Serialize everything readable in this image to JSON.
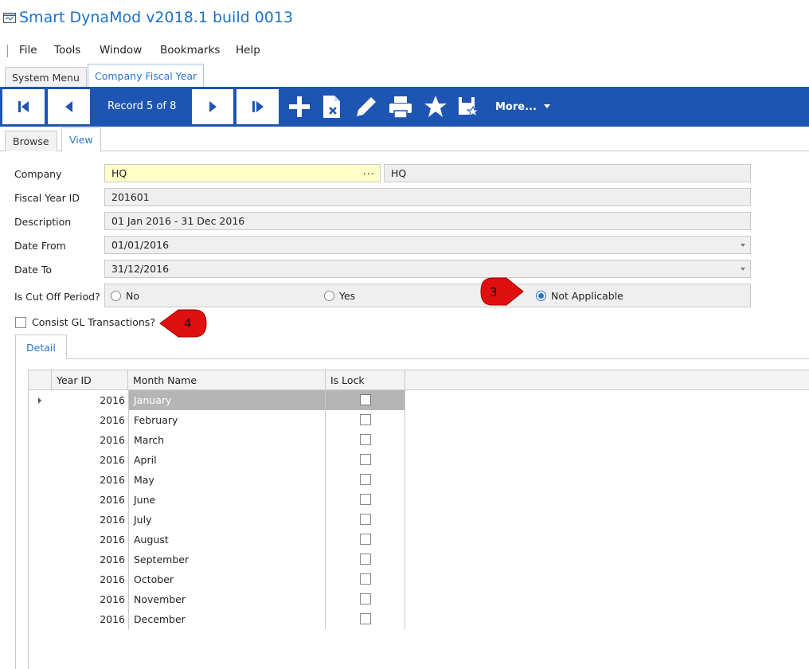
{
  "app": {
    "title": "Smart DynaMod v2018.1 build 0013"
  },
  "menu": {
    "items": [
      "File",
      "Tools",
      "Window",
      "Bookmarks",
      "Help"
    ]
  },
  "doc_tabs": [
    {
      "label": "System Menu",
      "active": false
    },
    {
      "label": "Company Fiscal Year",
      "active": true
    }
  ],
  "toolbar": {
    "record_label": "Record 5 of 8",
    "more_label": "More...",
    "accent_color": "#1e55b3",
    "icons": [
      "first-record-icon",
      "previous-record-icon",
      "next-record-icon",
      "last-record-icon",
      "add-icon",
      "delete-icon",
      "edit-icon",
      "print-icon",
      "bookmark-star-icon",
      "save-icon",
      "chevron-down-icon"
    ]
  },
  "view_tabs": [
    {
      "label": "Browse",
      "active": false
    },
    {
      "label": "View",
      "active": true
    }
  ],
  "form": {
    "company": {
      "label": "Company",
      "code": "HQ",
      "name": "HQ",
      "button": "..."
    },
    "fiscal_year_id": {
      "label": "Fiscal Year ID",
      "value": "201601"
    },
    "description": {
      "label": "Description",
      "value": "01 Jan 2016 - 31 Dec 2016"
    },
    "date_from": {
      "label": "Date From",
      "value": "01/01/2016"
    },
    "date_to": {
      "label": "Date To",
      "value": "31/12/2016"
    },
    "cut_off": {
      "label": "Is Cut Off Period?",
      "options": [
        "No",
        "Yes",
        "Not Applicable"
      ],
      "selected": "Not Applicable"
    },
    "consist_gl": {
      "label": "Consist GL Transactions?",
      "checked": false
    }
  },
  "callouts": [
    "3",
    "4"
  ],
  "detail": {
    "tab_label": "Detail",
    "columns": [
      "Year ID",
      "Month Name",
      "Is Lock"
    ],
    "rows": [
      {
        "year": "2016",
        "month": "January",
        "locked": false,
        "selected": true
      },
      {
        "year": "2016",
        "month": "February",
        "locked": false
      },
      {
        "year": "2016",
        "month": "March",
        "locked": false
      },
      {
        "year": "2016",
        "month": "April",
        "locked": false
      },
      {
        "year": "2016",
        "month": "May",
        "locked": false
      },
      {
        "year": "2016",
        "month": "June",
        "locked": false
      },
      {
        "year": "2016",
        "month": "July",
        "locked": false
      },
      {
        "year": "2016",
        "month": "August",
        "locked": false
      },
      {
        "year": "2016",
        "month": "September",
        "locked": false
      },
      {
        "year": "2016",
        "month": "October",
        "locked": false
      },
      {
        "year": "2016",
        "month": "November",
        "locked": false
      },
      {
        "year": "2016",
        "month": "December",
        "locked": false
      }
    ]
  }
}
